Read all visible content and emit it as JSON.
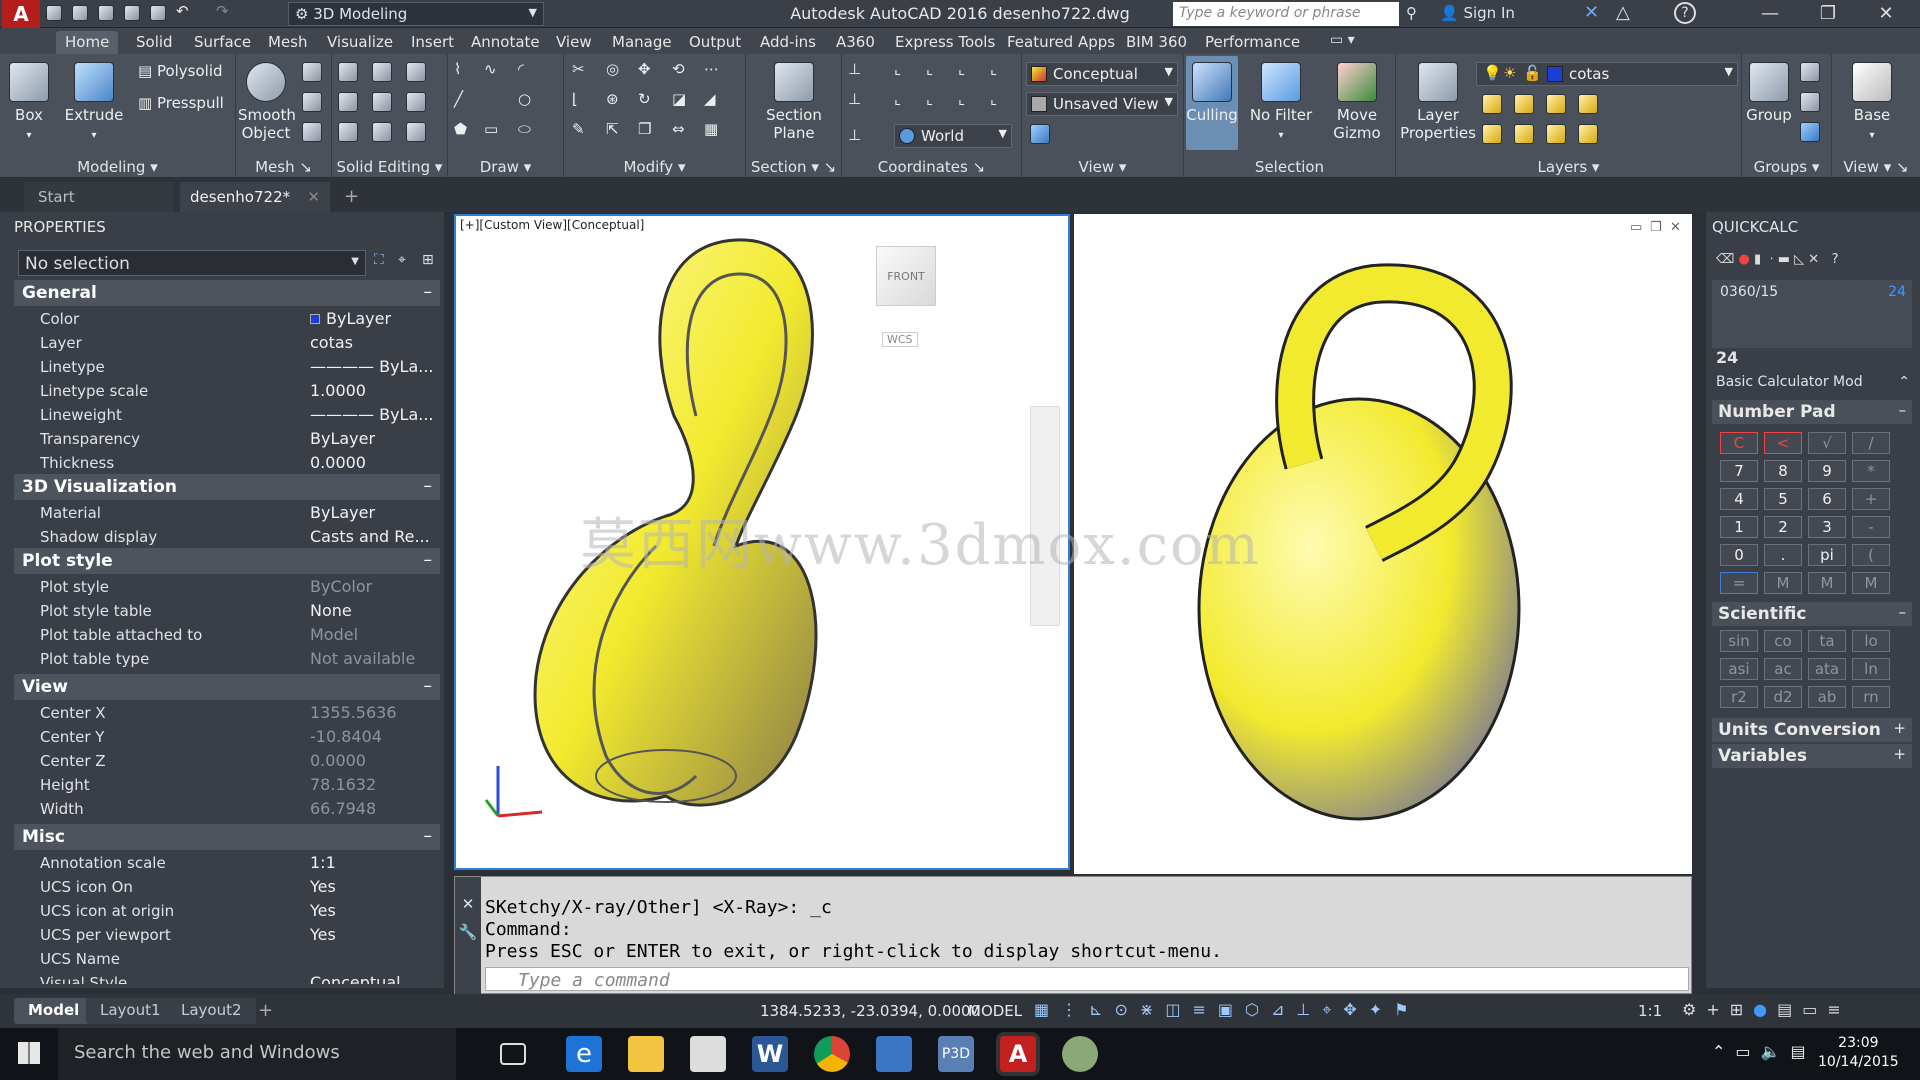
{
  "titlebar": {
    "workspace": "3D Modeling",
    "app_title": "Autodesk AutoCAD 2016    desenho722.dwg",
    "search_placeholder": "Type a keyword or phrase",
    "sign_in": "Sign In"
  },
  "menu_tabs": [
    "Home",
    "Solid",
    "Surface",
    "Mesh",
    "Visualize",
    "Insert",
    "Annotate",
    "View",
    "Manage",
    "Output",
    "Add-ins",
    "A360",
    "Express Tools",
    "Featured Apps",
    "BIM 360",
    "Performance"
  ],
  "ribbon": {
    "modeling": {
      "box": "Box",
      "extrude": "Extrude",
      "polysolid": "Polysolid",
      "presspull": "Presspull",
      "label": "Modeling"
    },
    "mesh": {
      "smooth_object_1": "Smooth",
      "smooth_object_2": "Object",
      "label": "Mesh"
    },
    "solid_editing": {
      "label": "Solid Editing"
    },
    "draw": {
      "label": "Draw"
    },
    "modify": {
      "label": "Modify"
    },
    "section": {
      "plane_1": "Section",
      "plane_2": "Plane",
      "label": "Section"
    },
    "coordinates": {
      "ucs_world": "World",
      "label": "Coordinates"
    },
    "view": {
      "visual_style": "Conceptual",
      "saved_view": "Unsaved View",
      "label": "View"
    },
    "selection": {
      "culling": "Culling",
      "no_filter": "No Filter",
      "move_gizmo_1": "Move",
      "move_gizmo_2": "Gizmo",
      "label": "Selection"
    },
    "layers": {
      "layer_properties_1": "Layer",
      "layer_properties_2": "Properties",
      "current_layer": "cotas",
      "label": "Layers"
    },
    "groups": {
      "group": "Group",
      "label": "Groups"
    },
    "view2": {
      "base": "Base",
      "label": "View"
    }
  },
  "doc_tabs": {
    "start": "Start",
    "current": "desenho722*"
  },
  "properties": {
    "header": "PROPERTIES",
    "selection": "No selection",
    "general": {
      "title": "General",
      "rows": [
        [
          "Color",
          "ByLayer"
        ],
        [
          "Layer",
          "cotas"
        ],
        [
          "Linetype",
          "———— ByLa..."
        ],
        [
          "Linetype scale",
          "1.0000"
        ],
        [
          "Lineweight",
          "———— ByLa..."
        ],
        [
          "Transparency",
          "ByLayer"
        ],
        [
          "Thickness",
          "0.0000"
        ]
      ]
    },
    "viz": {
      "title": "3D Visualization",
      "rows": [
        [
          "Material",
          "ByLayer"
        ],
        [
          "Shadow display",
          "Casts and Re..."
        ]
      ]
    },
    "plot": {
      "title": "Plot style",
      "rows": [
        [
          "Plot style",
          "ByColor"
        ],
        [
          "Plot style table",
          "None"
        ],
        [
          "Plot table attached to",
          "Model"
        ],
        [
          "Plot table type",
          "Not available"
        ]
      ]
    },
    "view": {
      "title": "View",
      "rows": [
        [
          "Center X",
          "1355.5636"
        ],
        [
          "Center Y",
          "-10.8404"
        ],
        [
          "Center Z",
          "0.0000"
        ],
        [
          "Height",
          "78.1632"
        ],
        [
          "Width",
          "66.7948"
        ]
      ]
    },
    "misc": {
      "title": "Misc",
      "rows": [
        [
          "Annotation scale",
          "1:1"
        ],
        [
          "UCS icon On",
          "Yes"
        ],
        [
          "UCS icon at origin",
          "Yes"
        ],
        [
          "UCS per viewport",
          "Yes"
        ],
        [
          "UCS Name",
          ""
        ],
        [
          "Visual Style",
          "Conceptual"
        ]
      ]
    }
  },
  "viewport": {
    "label": "[+][Custom View][Conceptual]",
    "cube_face": "FRONT",
    "wcs": "WCS"
  },
  "watermark": "莫西网www.3dmox.com",
  "command": {
    "line1": "SKetchy/X-ray/Other] <X-Ray>: _c",
    "line2": "Command:",
    "line3": "Press ESC or ENTER to exit, or right-click to display shortcut-menu.",
    "placeholder": "Type a command"
  },
  "quickcalc": {
    "header": "QUICKCALC",
    "expression": "0360/15",
    "expression_result": "24",
    "result": "24",
    "mode": "Basic Calculator Mod",
    "number_pad": "Number Pad",
    "keys": [
      [
        "C",
        "<",
        "√",
        "/"
      ],
      [
        "7",
        "8",
        "9",
        "*"
      ],
      [
        "4",
        "5",
        "6",
        "+"
      ],
      [
        "1",
        "2",
        "3",
        "-"
      ],
      [
        "0",
        ".",
        "pi",
        "("
      ],
      [
        "=",
        "M",
        "M",
        "M"
      ]
    ],
    "scientific": "Scientific",
    "sci_keys": [
      [
        "sin",
        "co",
        "ta",
        "lo"
      ],
      [
        "asi",
        "ac",
        "ata",
        "ln"
      ],
      [
        "r2",
        "d2",
        "ab",
        "rn"
      ]
    ],
    "units": "Units Conversion",
    "variables": "Variables"
  },
  "layout_tabs": [
    "Model",
    "Layout1",
    "Layout2"
  ],
  "status": {
    "coords": "1384.5233, -23.0394, 0.0000",
    "model": "MODEL",
    "scale": "1:1"
  },
  "taskbar": {
    "search": "Search the web and Windows",
    "time": "23:09",
    "date": "10/14/2015"
  },
  "colors": {
    "accent": "#2f7fd6",
    "object_yellow": "#f2ea2e",
    "layer_color": "#1b3fd1"
  }
}
